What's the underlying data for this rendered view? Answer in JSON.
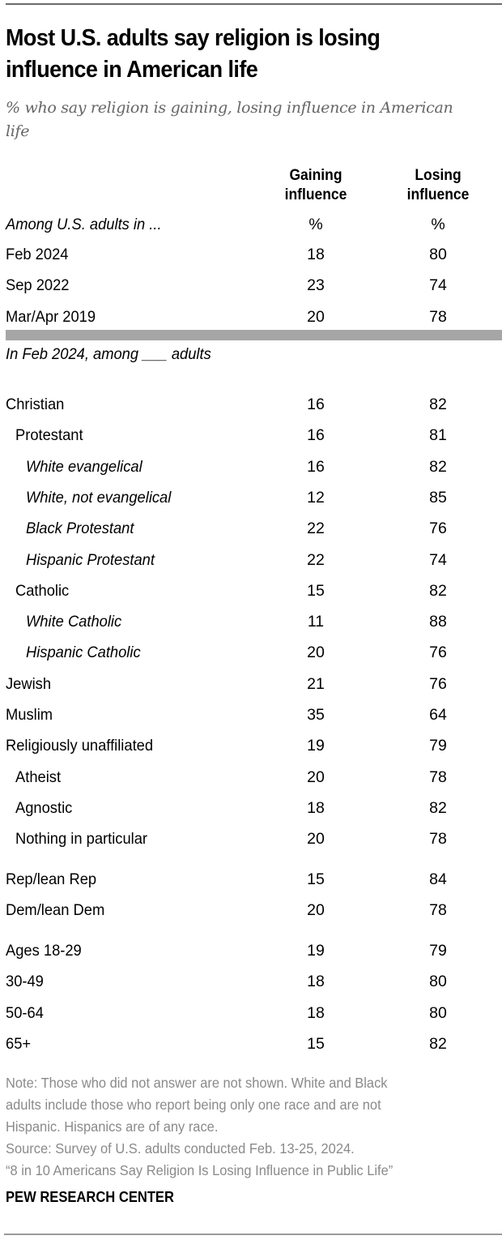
{
  "title": "Most U.S. adults say religion is losing influence in American life",
  "subtitle": "% who say religion is gaining, losing influence in American life",
  "columns": {
    "gaining": "Gaining influence",
    "losing": "Losing influence"
  },
  "notes": {
    "note_lines": [
      "Note: Those who did not answer are not shown. White and Black",
      "adults include those who report being only one race and are not",
      "Hispanic. Hispanics are of any race."
    ],
    "source": "Source: Survey of U.S. adults conducted Feb. 13-25, 2024.",
    "report": "“8 in 10 Americans Say Religion Is Losing Influence in Public Life”",
    "brand": "PEW RESEARCH CENTER"
  },
  "chart_data": {
    "type": "table",
    "title": "Most U.S. adults say religion is losing influence in American life",
    "subtitle": "% who say religion is gaining, losing influence in American life",
    "columns": [
      "Gaining influence",
      "Losing influence"
    ],
    "sections": [
      {
        "label": "Among U.S. adults in ...",
        "unit_row": [
          "%",
          "%"
        ],
        "rows": [
          {
            "label": "Feb 2024",
            "level": 0,
            "gaining": 18,
            "losing": 80
          },
          {
            "label": "Sep 2022",
            "level": 0,
            "gaining": 23,
            "losing": 74
          },
          {
            "label": "Mar/Apr 2019",
            "level": 0,
            "gaining": 20,
            "losing": 78
          }
        ]
      },
      {
        "label": "In Feb 2024, among ___ adults",
        "rows": [
          {
            "label": "Christian",
            "level": 0,
            "gaining": 16,
            "losing": 82
          },
          {
            "label": "Protestant",
            "level": 1,
            "gaining": 16,
            "losing": 81
          },
          {
            "label": "White evangelical",
            "level": 2,
            "gaining": 16,
            "losing": 82
          },
          {
            "label": "White, not evangelical",
            "level": 2,
            "gaining": 12,
            "losing": 85
          },
          {
            "label": "Black Protestant",
            "level": 2,
            "gaining": 22,
            "losing": 76
          },
          {
            "label": "Hispanic Protestant",
            "level": 2,
            "gaining": 22,
            "losing": 74
          },
          {
            "label": "Catholic",
            "level": 1,
            "gaining": 15,
            "losing": 82
          },
          {
            "label": "White Catholic",
            "level": 2,
            "gaining": 11,
            "losing": 88
          },
          {
            "label": "Hispanic Catholic",
            "level": 2,
            "gaining": 20,
            "losing": 76
          },
          {
            "label": "Jewish",
            "level": 0,
            "gaining": 21,
            "losing": 76
          },
          {
            "label": "Muslim",
            "level": 0,
            "gaining": 35,
            "losing": 64
          },
          {
            "label": "Religiously unaffiliated",
            "level": 0,
            "gaining": 19,
            "losing": 79
          },
          {
            "label": "Atheist",
            "level": 1,
            "gaining": 20,
            "losing": 78
          },
          {
            "label": "Agnostic",
            "level": 1,
            "gaining": 18,
            "losing": 82
          },
          {
            "label": "Nothing in particular",
            "level": 1,
            "gaining": 20,
            "losing": 78
          },
          {
            "label": "Rep/lean Rep",
            "level": 0,
            "gaining": 15,
            "losing": 84
          },
          {
            "label": "Dem/lean Dem",
            "level": 0,
            "gaining": 20,
            "losing": 78
          },
          {
            "label": "Ages 18-29",
            "level": 0,
            "gaining": 19,
            "losing": 79
          },
          {
            "label": "30-49",
            "level": 0,
            "gaining": 18,
            "losing": 80
          },
          {
            "label": "50-64",
            "level": 0,
            "gaining": 18,
            "losing": 80
          },
          {
            "label": "65+",
            "level": 0,
            "gaining": 15,
            "losing": 82
          }
        ]
      }
    ]
  }
}
